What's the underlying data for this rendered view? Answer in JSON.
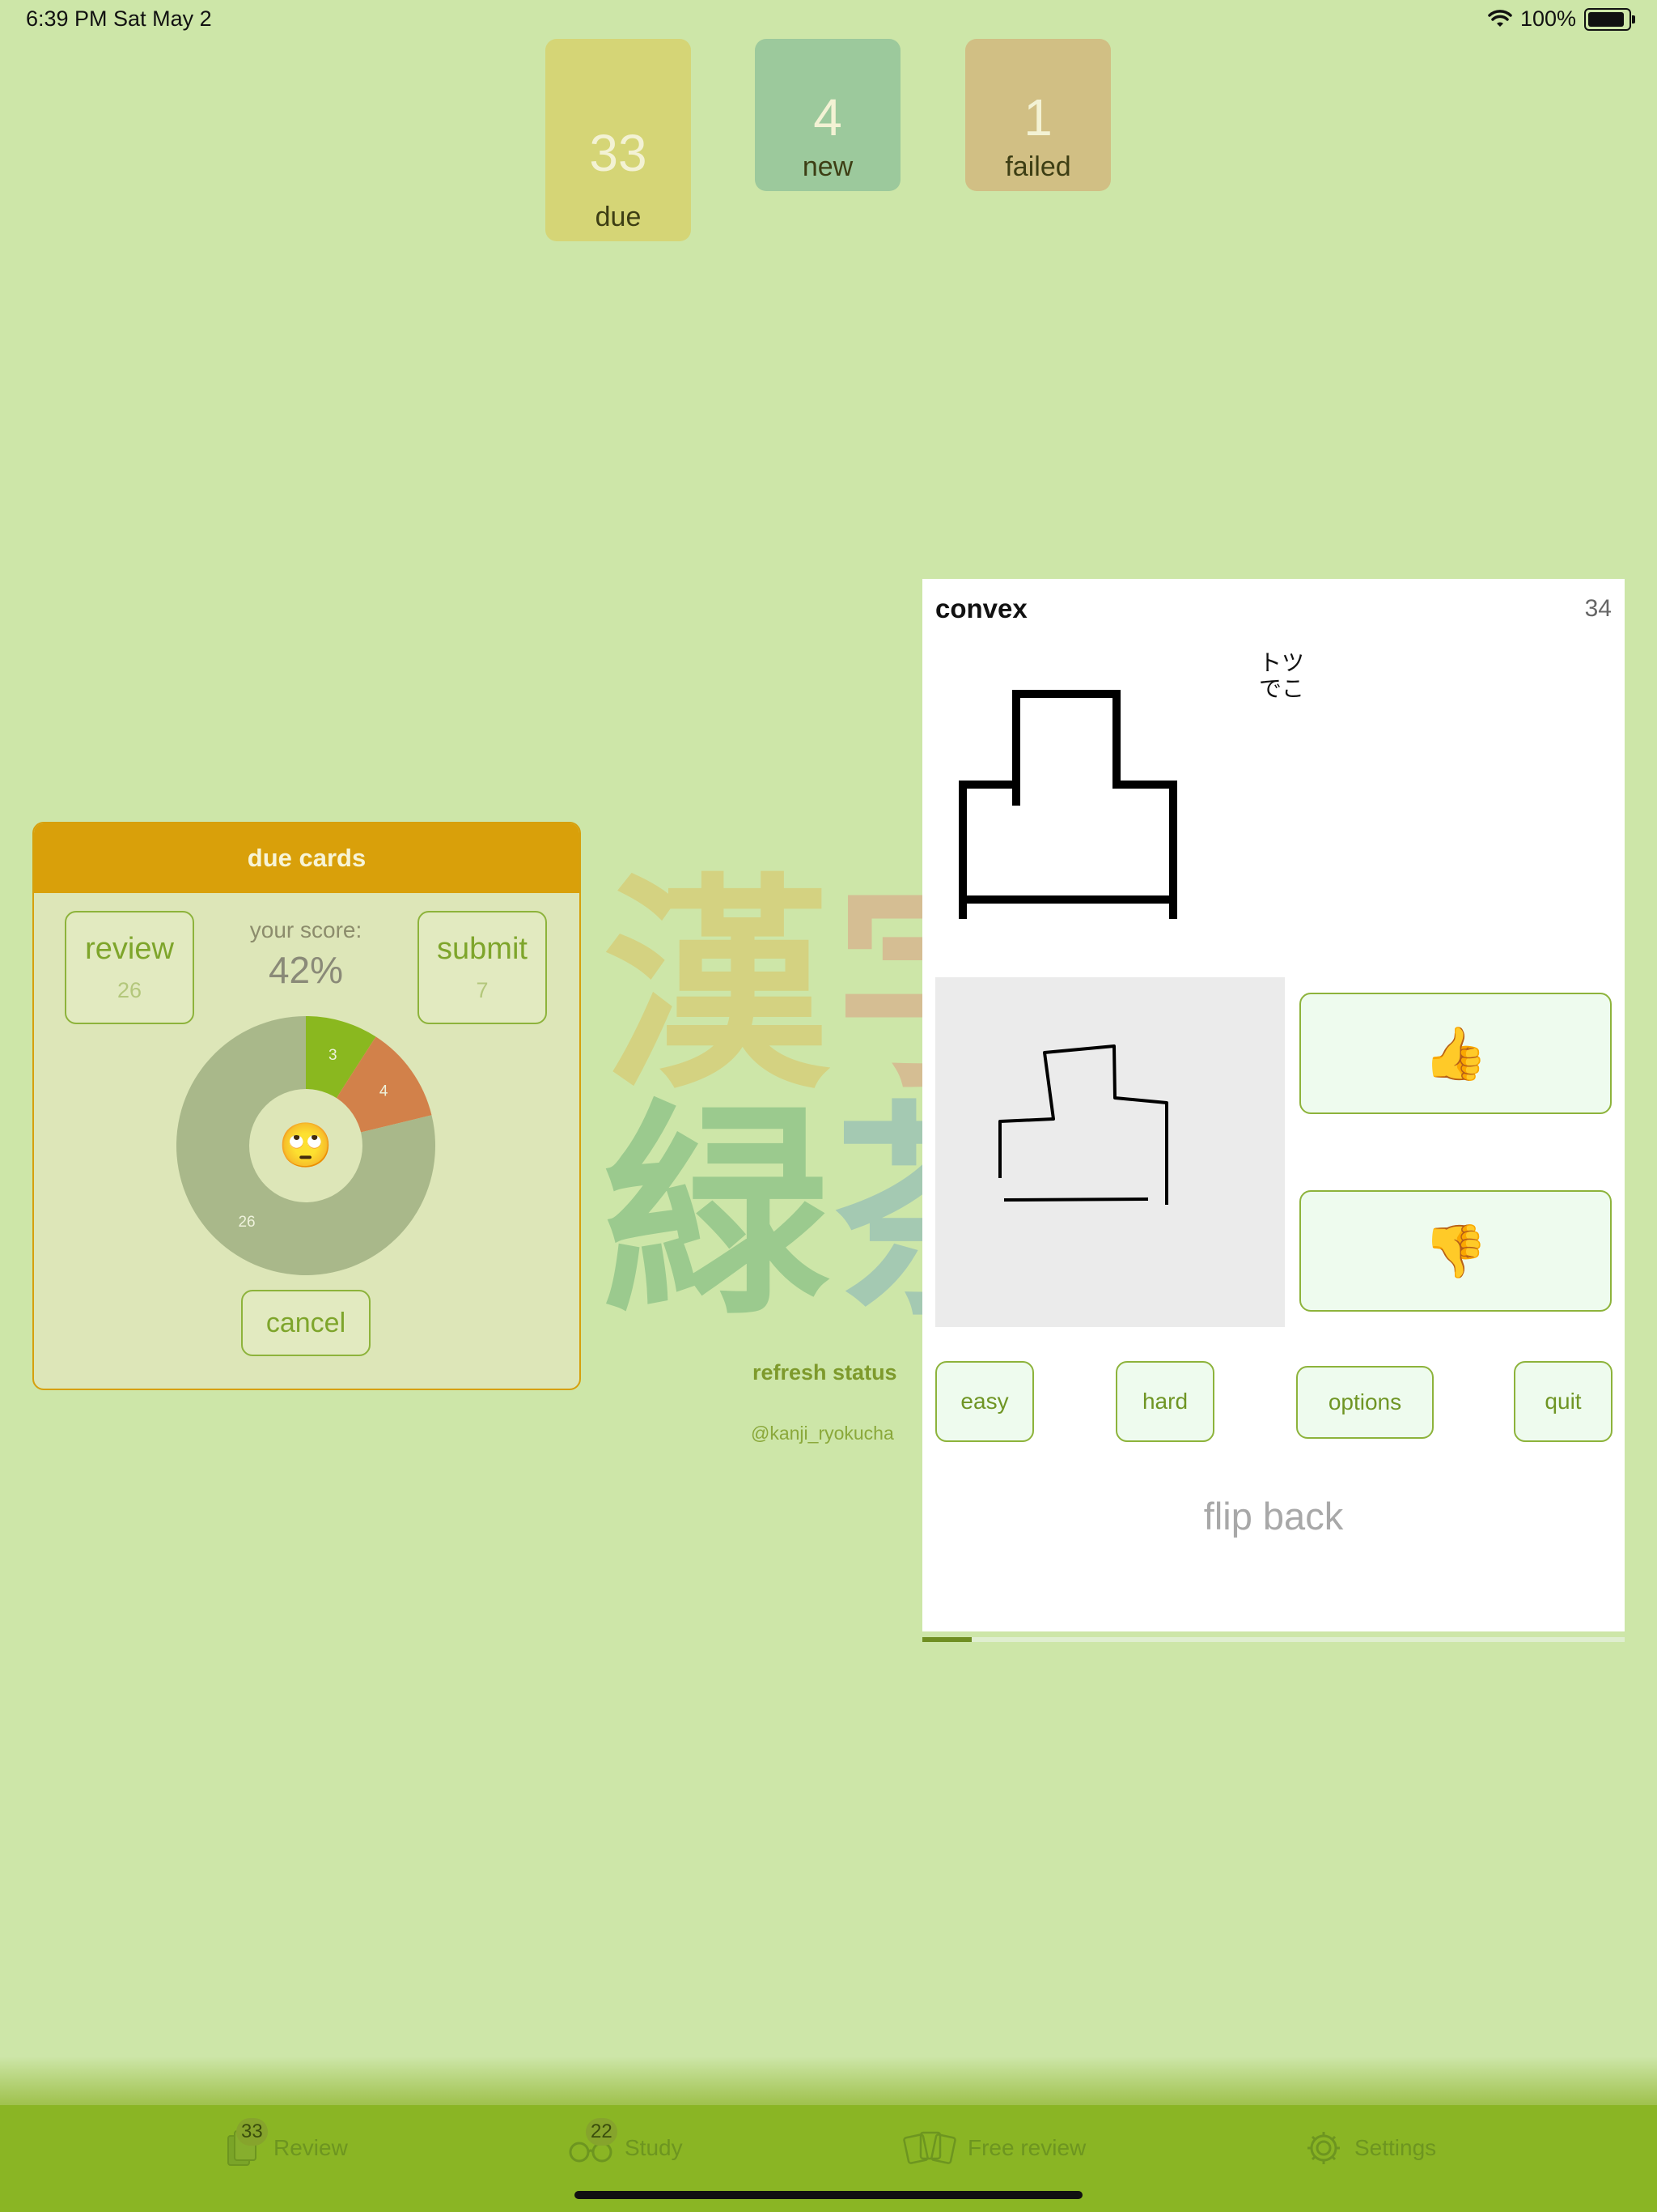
{
  "status_bar": {
    "time_date": "6:39 PM   Sat May 2",
    "battery": "100%",
    "battery_level": 1.0
  },
  "counters": {
    "due": {
      "value": "33",
      "label": "due"
    },
    "new": {
      "value": "4",
      "label": "new"
    },
    "failed": {
      "value": "1",
      "label": "failed"
    }
  },
  "background": {
    "kanji_line1": [
      "漢",
      "字"
    ],
    "kanji_line2": [
      "緑",
      "茶"
    ],
    "refresh_label": "refresh status",
    "handle": "@kanji_ryokucha"
  },
  "due_panel": {
    "title": "due cards",
    "review_label": "review",
    "review_count": "26",
    "submit_label": "submit",
    "submit_count": "7",
    "score_label": "your score:",
    "score_value": "42%",
    "cancel_label": "cancel",
    "center_emoji": "🙄",
    "colors": {
      "header": "#d9a00a",
      "border": "#d6a00d",
      "accent": "#8db33b"
    }
  },
  "chart_data": {
    "type": "pie",
    "categories": [
      "",
      "",
      ""
    ],
    "values": [
      3,
      4,
      26
    ],
    "labels": [
      "3",
      "4",
      "26"
    ],
    "colors": [
      "#8ab81f",
      "#d2814a",
      "#a9b88a"
    ]
  },
  "flashcard": {
    "title": "convex",
    "count": "34",
    "reading_line1": "トツ",
    "reading_line2": "でこ",
    "thumbs_up": "👍",
    "thumbs_down": "👎",
    "buttons": {
      "easy": "easy",
      "hard": "hard",
      "options": "options",
      "quit": "quit"
    },
    "flip_label": "flip back",
    "progress": 0.07
  },
  "tab_bar": {
    "items": [
      {
        "label": "Review",
        "badge": "33",
        "icon": "cards-icon"
      },
      {
        "label": "Study",
        "badge": "22",
        "icon": "glasses-icon"
      },
      {
        "label": "Free review",
        "icon": "shuffle-cards-icon"
      },
      {
        "label": "Settings",
        "icon": "gear-icon"
      }
    ]
  }
}
